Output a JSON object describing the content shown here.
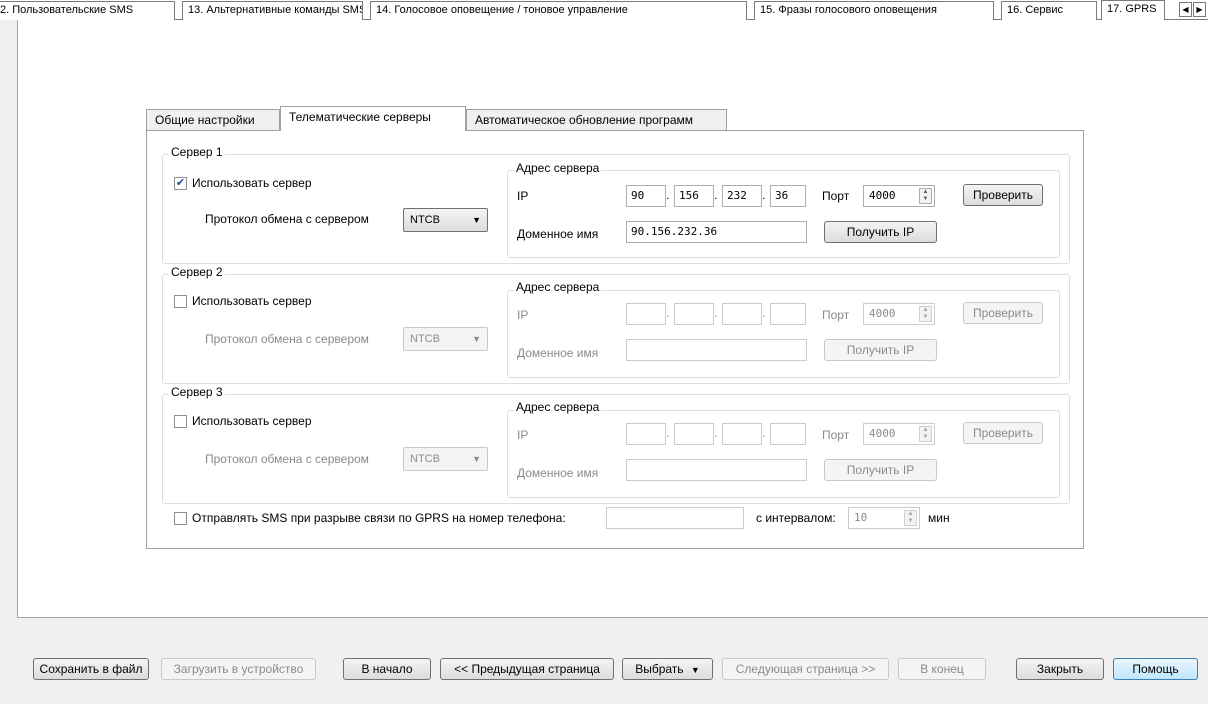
{
  "top_tabs": [
    {
      "label": "2. Пользовательские SMS"
    },
    {
      "label": "13. Альтернативные команды SMS"
    },
    {
      "label": "14. Голосовое оповещение / тоновое управление"
    },
    {
      "label": "15. Фразы голосового оповещения"
    },
    {
      "label": "16. Сервис"
    },
    {
      "label": "17. GPRS"
    }
  ],
  "scroll": {
    "left_icon": "scroll-left-icon",
    "right_icon": "scroll-right-icon"
  },
  "inner_tabs": [
    {
      "label": "Общие настройки"
    },
    {
      "label": "Телематические серверы"
    },
    {
      "label": "Автоматическое обновление программ"
    }
  ],
  "servers": [
    {
      "title": "Сервер 1",
      "use_label": "Использовать сервер",
      "checked": true,
      "protocol_label": "Протокол обмена с сервером",
      "protocol_value": "NTCB",
      "addr_title": "Адрес сервера",
      "ip_label": "IP",
      "ip": [
        "90",
        "156",
        "232",
        "36"
      ],
      "port_label": "Порт",
      "port_value": "4000",
      "check_btn": "Проверить",
      "domain_label": "Доменное имя",
      "domain_value": "90.156.232.36",
      "getip_btn": "Получить IP"
    },
    {
      "title": "Сервер 2",
      "use_label": "Использовать сервер",
      "checked": false,
      "protocol_label": "Протокол обмена с сервером",
      "protocol_value": "NTCB",
      "addr_title": "Адрес сервера",
      "ip_label": "IP",
      "ip": [
        "",
        "",
        "",
        ""
      ],
      "port_label": "Порт",
      "port_value": "4000",
      "check_btn": "Проверить",
      "domain_label": "Доменное имя",
      "domain_value": "",
      "getip_btn": "Получить IP"
    },
    {
      "title": "Сервер 3",
      "use_label": "Использовать сервер",
      "checked": false,
      "protocol_label": "Протокол обмена с сервером",
      "protocol_value": "NTCB",
      "addr_title": "Адрес сервера",
      "ip_label": "IP",
      "ip": [
        "",
        "",
        "",
        ""
      ],
      "port_label": "Порт",
      "port_value": "4000",
      "check_btn": "Проверить",
      "domain_label": "Доменное имя",
      "domain_value": "",
      "getip_btn": "Получить IP"
    }
  ],
  "sms": {
    "label": "Отправлять SMS при разрыве связи по GPRS на номер телефона:",
    "phone": "",
    "interval_label": "с интервалом:",
    "interval_value": "10",
    "unit": "мин"
  },
  "bottom": {
    "save": "Сохранить в файл",
    "load": "Загрузить в устройство",
    "begin": "В начало",
    "prev": "<< Предыдущая страница",
    "select": "Выбрать",
    "next": "Следующая страница >>",
    "end": "В конец",
    "close": "Закрыть",
    "help": "Помощь"
  }
}
